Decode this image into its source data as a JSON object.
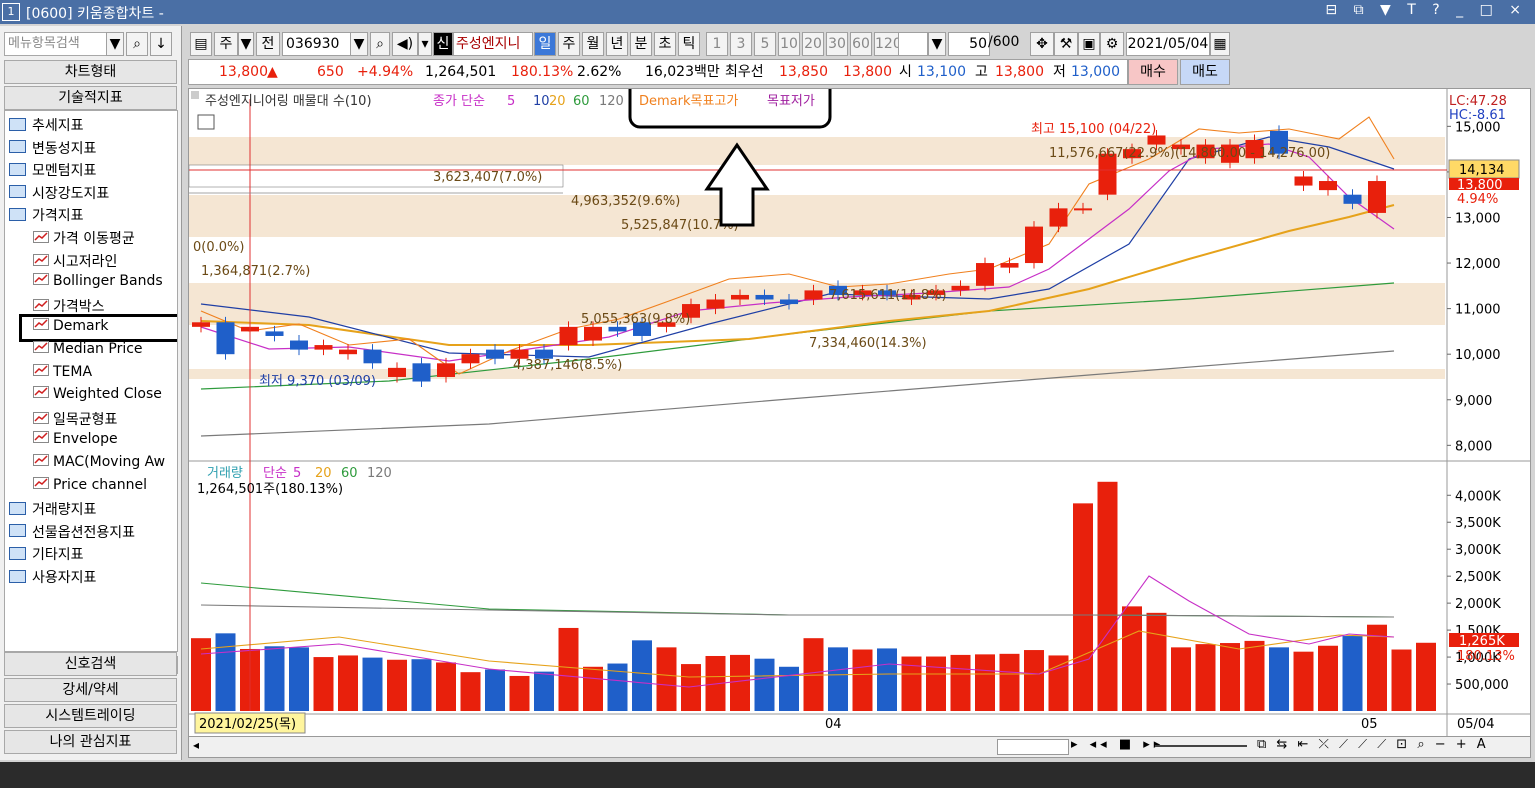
{
  "window": {
    "number": "1",
    "title": "[0600] 키움종합차트 -",
    "controls": "⊟ ⧉ ▼ T ? _ □ ×"
  },
  "left": {
    "search_placeholder": "메뉴항목검색",
    "btn_chart_type": "차트형태",
    "btn_tech_indicator": "기술적지표",
    "tree": [
      {
        "type": "folder",
        "label": "추세지표"
      },
      {
        "type": "folder",
        "label": "변동성지표"
      },
      {
        "type": "folder",
        "label": "모멘텀지표"
      },
      {
        "type": "folder",
        "label": "시장강도지표"
      },
      {
        "type": "folder-open",
        "label": "가격지표"
      },
      {
        "type": "item",
        "label": "가격 이동평균"
      },
      {
        "type": "item",
        "label": "시고저라인"
      },
      {
        "type": "item",
        "label": "Bollinger Bands"
      },
      {
        "type": "item",
        "label": "가격박스"
      },
      {
        "type": "item",
        "label": "Demark"
      },
      {
        "type": "item",
        "label": "Median Price"
      },
      {
        "type": "item",
        "label": "TEMA"
      },
      {
        "type": "item",
        "label": "Weighted Close"
      },
      {
        "type": "item",
        "label": "일목균형표"
      },
      {
        "type": "item",
        "label": "Envelope"
      },
      {
        "type": "item",
        "label": "MAC(Moving Aw"
      },
      {
        "type": "item",
        "label": "Price channel"
      },
      {
        "type": "folder",
        "label": "거래량지표"
      },
      {
        "type": "folder",
        "label": "선물옵션전용지표"
      },
      {
        "type": "folder",
        "label": "기타지표"
      },
      {
        "type": "folder",
        "label": "사용자지표"
      }
    ],
    "btn_signal": "신호검색",
    "btn_strength": "강세/약세",
    "btn_system": "시스템트레이딩",
    "btn_mine": "나의 관심지표"
  },
  "toolbar": {
    "jong": "주",
    "jeon": "전",
    "code": "036930",
    "shin": "신",
    "name": "주성엔지니",
    "periods": [
      "일",
      "주",
      "월",
      "년",
      "분",
      "초",
      "틱"
    ],
    "numbers": [
      "1",
      "3",
      "5",
      "10",
      "20",
      "30",
      "60",
      "120"
    ],
    "count": "50",
    "total": "/600",
    "date": "2021/05/04"
  },
  "quote": {
    "price": "13,800",
    "arrow": "▲",
    "change": "650",
    "rate": "+4.94%",
    "volume": "1,264,501",
    "vol_ratio": "180.13%",
    "turnover": "2.62%",
    "amount": "16,023백만",
    "best": "최우선",
    "best_px": "13,850",
    "best_px2": "13,800",
    "open_lbl": "시",
    "open": "13,100",
    "high_lbl": "고",
    "high": "13,800",
    "low_lbl": "저",
    "low": "13,000",
    "buy": "매수",
    "sell": "매도"
  },
  "price_panel": {
    "legend_name": "주성엔지니어링 매물대 수(10)",
    "legend_ma_prefix": "종가 단순",
    "legend_ma": [
      "5",
      "10",
      "20",
      "60",
      "120"
    ],
    "legend_demark_high": "Demark목표고가",
    "legend_demark_low": "목표저가",
    "lc": "LC:47.28",
    "hc": "HC:-8.61",
    "high_note": "최고 15,100 (04/22)",
    "low_note": "최저 9,370 (03/09)",
    "cur_price": "14,134",
    "cur_tag": "13,800",
    "cur_rate": "4.94%",
    "y_ticks": [
      "15,000",
      "14,000",
      "13,000",
      "12,000",
      "11,000",
      "10,000",
      "9,000",
      "8,000"
    ],
    "volume_profile": [
      {
        "label": "11,576,667(22.9%)(14,800.00 - 14,276.00)"
      },
      {
        "label": "3,623,407(7.0%)"
      },
      {
        "label": "4,963,352(9.6%)"
      },
      {
        "label": "5,525,847(10.7%)"
      },
      {
        "label": "0(0.0%)"
      },
      {
        "label": "1,364,871(2.7%)"
      },
      {
        "label": "5,055,363(9.8%)"
      },
      {
        "label": "4,387,146(8.5%)"
      },
      {
        "label": "7,334,460(14.3%)"
      },
      {
        "label": "7,615,611(14.8%)"
      }
    ]
  },
  "volume_panel": {
    "legend_name": "거래량",
    "legend_ma_prefix": "단순",
    "legend_ma": [
      "5",
      "20",
      "60",
      "120"
    ],
    "vol_info": "1,264,501주(180.13%)",
    "y_ticks": [
      "4,000K",
      "3,500K",
      "3,000K",
      "2,500K",
      "2,000K",
      "1,500K",
      "1,000K",
      "500,000"
    ],
    "cur_tag": "1,265K",
    "cur_rate": "180.13%"
  },
  "xaxis": {
    "cursor_date": "2021/02/25(목)",
    "apr": "04",
    "may": "05",
    "end": "05/04"
  },
  "chart_data": {
    "type": "candlestick",
    "candles": [
      {
        "o": 10600,
        "c": 10700
      },
      {
        "o": 10700,
        "c": 10000
      },
      {
        "o": 10500,
        "c": 10600
      },
      {
        "o": 10500,
        "c": 10400
      },
      {
        "o": 10300,
        "c": 10100
      },
      {
        "o": 10100,
        "c": 10200
      },
      {
        "o": 10000,
        "c": 10100
      },
      {
        "o": 10100,
        "c": 9800
      },
      {
        "o": 9500,
        "c": 9700
      },
      {
        "o": 9800,
        "c": 9400
      },
      {
        "o": 9500,
        "c": 9800
      },
      {
        "o": 9800,
        "c": 10000
      },
      {
        "o": 10100,
        "c": 9900
      },
      {
        "o": 9900,
        "c": 10100
      },
      {
        "o": 10100,
        "c": 9900
      },
      {
        "o": 10200,
        "c": 10600
      },
      {
        "o": 10300,
        "c": 10600
      },
      {
        "o": 10600,
        "c": 10500
      },
      {
        "o": 10700,
        "c": 10400
      },
      {
        "o": 10600,
        "c": 10700
      },
      {
        "o": 10800,
        "c": 11100
      },
      {
        "o": 11000,
        "c": 11200
      },
      {
        "o": 11200,
        "c": 11300
      },
      {
        "o": 11300,
        "c": 11200
      },
      {
        "o": 11200,
        "c": 11100
      },
      {
        "o": 11200,
        "c": 11400
      },
      {
        "o": 11500,
        "c": 11300
      },
      {
        "o": 11300,
        "c": 11400
      },
      {
        "o": 11400,
        "c": 11300
      },
      {
        "o": 11200,
        "c": 11300
      },
      {
        "o": 11300,
        "c": 11400
      },
      {
        "o": 11400,
        "c": 11500
      },
      {
        "o": 11500,
        "c": 12000
      },
      {
        "o": 11900,
        "c": 12000
      },
      {
        "o": 12000,
        "c": 12800
      },
      {
        "o": 12800,
        "c": 13200
      },
      {
        "o": 13200,
        "c": 13200
      },
      {
        "o": 13500,
        "c": 14400
      },
      {
        "o": 14300,
        "c": 14500
      },
      {
        "o": 14600,
        "c": 14800
      },
      {
        "o": 14500,
        "c": 14600
      },
      {
        "o": 14300,
        "c": 14600
      },
      {
        "o": 14200,
        "c": 14600
      },
      {
        "o": 14300,
        "c": 14700
      },
      {
        "o": 14900,
        "c": 14400
      },
      {
        "o": 13700,
        "c": 13900
      },
      {
        "o": 13600,
        "c": 13800
      },
      {
        "o": 13500,
        "c": 13300
      },
      {
        "o": 13100,
        "c": 13800
      }
    ],
    "volumes_k": [
      1350,
      1440,
      1150,
      1200,
      1180,
      1000,
      1030,
      990,
      950,
      960,
      900,
      720,
      770,
      650,
      730,
      1540,
      820,
      880,
      1310,
      1180,
      870,
      1020,
      1040,
      970,
      820,
      1350,
      1180,
      1140,
      1160,
      1010,
      1010,
      1040,
      1050,
      1060,
      1130,
      1030,
      3850,
      4250,
      1940,
      1820,
      1180,
      1240,
      1260,
      1300,
      1180,
      1100,
      1210,
      1390,
      1600,
      1140,
      1265
    ],
    "ylim": [
      7700,
      15600
    ],
    "vol_ylim": [
      0,
      4450
    ]
  },
  "colors": {
    "up": "#e8200c",
    "down": "#1f5fc9",
    "ma5": "#c72fc7",
    "ma10": "#1f3fa5",
    "ma20": "#e6a21a",
    "ma60": "#2e9b3c",
    "ma120": "#7a7a7a",
    "demark": "#f0801e",
    "accent": "#3c78d8"
  }
}
